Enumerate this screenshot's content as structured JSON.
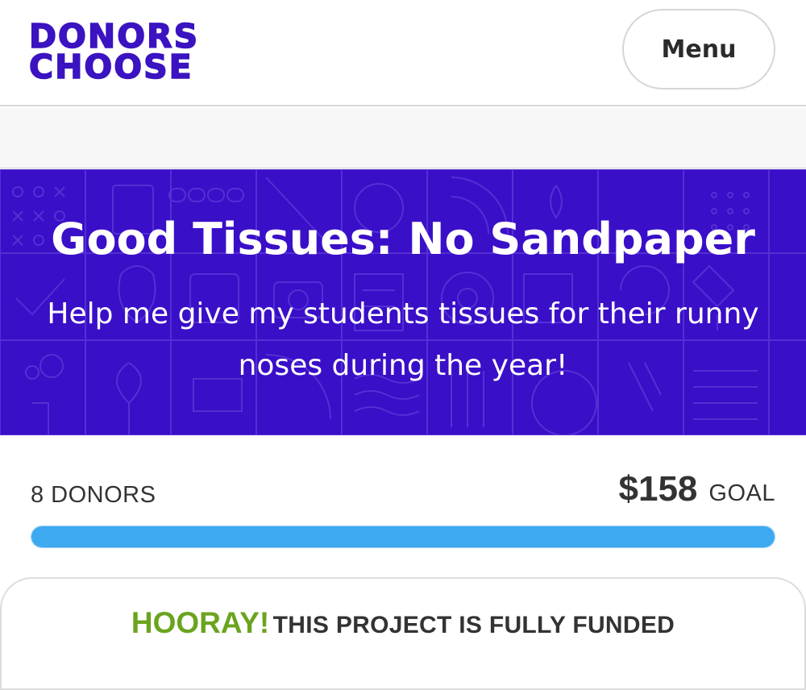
{
  "header": {
    "logo_line1": "DONORS",
    "logo_line2": "CHOOSE",
    "menu_label": "Menu"
  },
  "project": {
    "title": "Good Tissues: No Sandpaper",
    "subtitle": "Help me give my students tissues for their runny noses during the year!"
  },
  "funding": {
    "donors_label": "8 DONORS",
    "goal_amount": "$158",
    "goal_label": "GOAL",
    "progress_fraction": 1.0
  },
  "status": {
    "hooray": "HOORAY!",
    "message": "THIS PROJECT IS FULLY FUNDED"
  },
  "colors": {
    "brand": "#3b13c1",
    "hero_background": "#3a0fc8",
    "progress": "#3da9f0",
    "hooray": "#6aa41e"
  }
}
